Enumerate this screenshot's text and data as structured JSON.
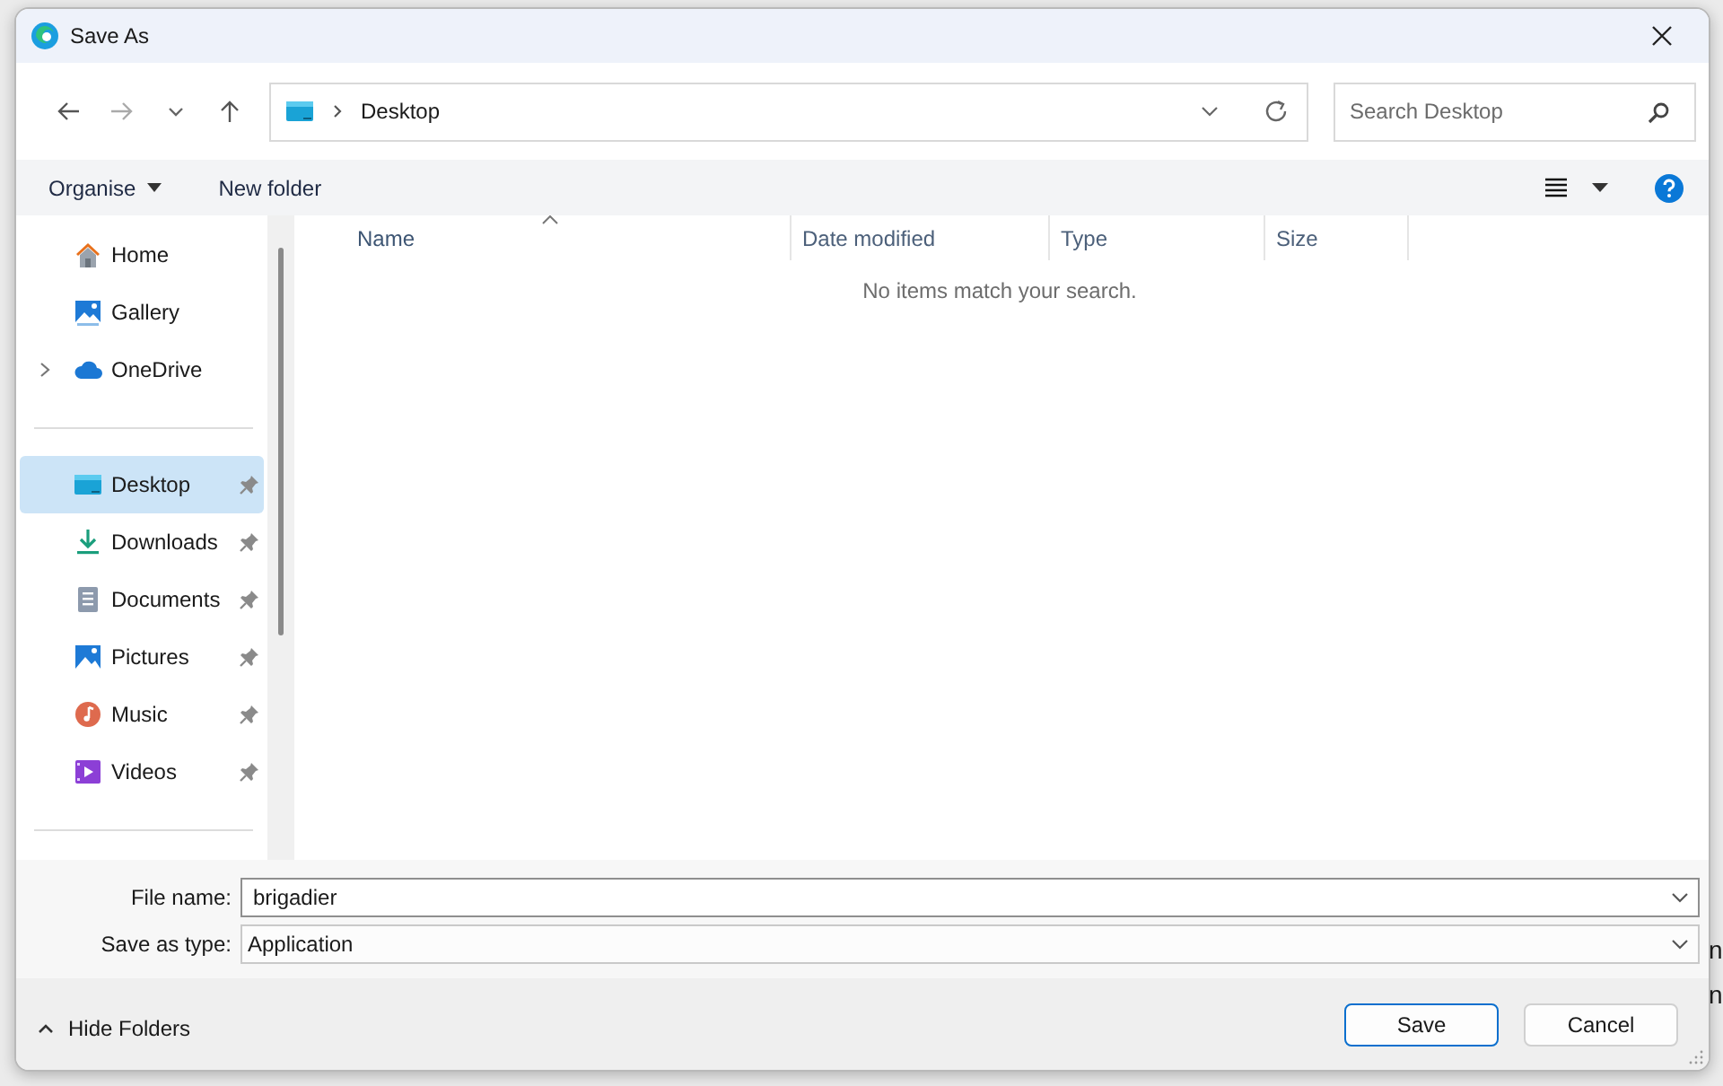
{
  "window": {
    "title": "Save As"
  },
  "address": {
    "path": [
      "Desktop"
    ]
  },
  "search": {
    "placeholder": "Search Desktop"
  },
  "command_bar": {
    "organise": "Organise",
    "new_folder": "New folder"
  },
  "sidebar": {
    "groups": [
      [
        {
          "label": "Home",
          "kind": "home",
          "expandable": false,
          "pinned": false,
          "selected": false
        },
        {
          "label": "Gallery",
          "kind": "gallery",
          "expandable": false,
          "pinned": false,
          "selected": false
        },
        {
          "label": "OneDrive",
          "kind": "cloud",
          "expandable": true,
          "pinned": false,
          "selected": false
        }
      ],
      [
        {
          "label": "Desktop",
          "kind": "desktop",
          "expandable": false,
          "pinned": true,
          "selected": true
        },
        {
          "label": "Downloads",
          "kind": "downloads",
          "expandable": false,
          "pinned": true,
          "selected": false
        },
        {
          "label": "Documents",
          "kind": "documents",
          "expandable": false,
          "pinned": true,
          "selected": false
        },
        {
          "label": "Pictures",
          "kind": "pictures",
          "expandable": false,
          "pinned": true,
          "selected": false
        },
        {
          "label": "Music",
          "kind": "music",
          "expandable": false,
          "pinned": true,
          "selected": false
        },
        {
          "label": "Videos",
          "kind": "videos",
          "expandable": false,
          "pinned": true,
          "selected": false
        }
      ]
    ]
  },
  "table": {
    "columns": [
      {
        "label": "Name",
        "sorted": true
      },
      {
        "label": "Date modified",
        "sorted": false
      },
      {
        "label": "Type",
        "sorted": false
      },
      {
        "label": "Size",
        "sorted": false
      }
    ],
    "empty_message": "No items match your search."
  },
  "file_name": {
    "label": "File name:",
    "value": "brigadier"
  },
  "save_type": {
    "label": "Save as type:",
    "value": "Application"
  },
  "hide_folders": "Hide Folders",
  "buttons": [
    {
      "label": "Save",
      "default": true
    },
    {
      "label": "Cancel",
      "default": false
    }
  ],
  "background_texts": [
    "n",
    "n"
  ]
}
